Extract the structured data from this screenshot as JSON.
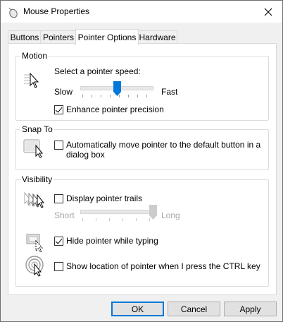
{
  "window": {
    "title": "Mouse Properties",
    "title_icon": "mouse-icon",
    "close_icon": "close-icon"
  },
  "tabs": [
    {
      "label": "Buttons",
      "active": false
    },
    {
      "label": "Pointers",
      "active": false
    },
    {
      "label": "Pointer Options",
      "active": true
    },
    {
      "label": "Hardware",
      "active": false
    }
  ],
  "motion": {
    "group_label": "Motion",
    "speed_label": "Select a pointer speed:",
    "slow_label": "Slow",
    "fast_label": "Fast",
    "speed_value": 0.5,
    "enhance_label": "Enhance pointer precision",
    "enhance_checked": true,
    "icon": "pointer-speed-icon"
  },
  "snap_to": {
    "group_label": "Snap To",
    "auto_move_label_line1": "Automatically move pointer to the default button in a",
    "auto_move_label_line2": "dialog box",
    "auto_move_checked": false,
    "icon": "snap-to-button-icon"
  },
  "visibility": {
    "group_label": "Visibility",
    "trails_label": "Display pointer trails",
    "trails_checked": false,
    "short_label": "Short",
    "long_label": "Long",
    "trails_value": 1.0,
    "hide_label": "Hide pointer while typing",
    "hide_checked": true,
    "show_location_label": "Show location of pointer when I press the CTRL key",
    "show_location_checked": false,
    "icons": [
      "pointer-trails-icon",
      "hide-pointer-icon",
      "pointer-location-icon"
    ]
  },
  "buttons": {
    "ok": "OK",
    "cancel": "Cancel",
    "apply": "Apply"
  },
  "colors": {
    "accent": "#0078d7",
    "disabled_text": "#a6a6a6",
    "window_bg": "#f0f0f0",
    "panel_bg": "#ffffff"
  }
}
